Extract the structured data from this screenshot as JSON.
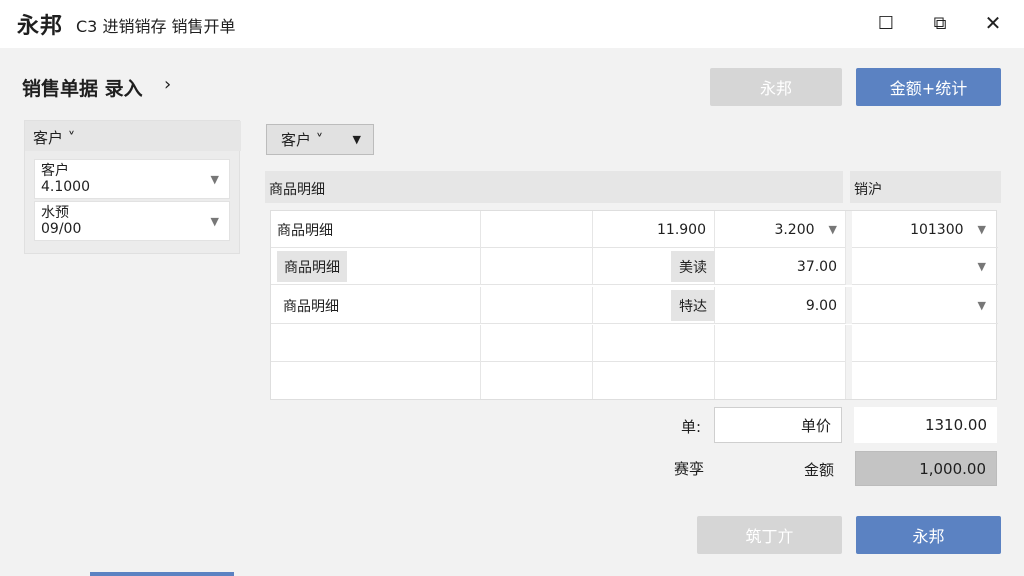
{
  "window": {
    "app_name": "永邦",
    "title": "C3 进销销存 销售开单",
    "controls": {
      "minimize": "☐",
      "restore": "⧉",
      "close": "✕"
    }
  },
  "page": {
    "title": "销售单据 录入",
    "chevron": "›"
  },
  "toolbar": {
    "grey_button": "永邦",
    "blue_button": "金额+统计"
  },
  "left_panel": {
    "header": "客户 ˅",
    "fields": [
      {
        "label": "客户",
        "value": "4.1000"
      },
      {
        "label": "水预",
        "value": "09/00"
      }
    ]
  },
  "filter": {
    "label": "客户 ˅"
  },
  "grid": {
    "header_main": "商品明细",
    "header_side": "销沪",
    "rows": [
      {
        "c1": "商品明细",
        "c3": "11.900",
        "c4": "3.200",
        "c5": "101300"
      },
      {
        "c1": "商品明细",
        "tag": "美读",
        "c4": "37.00",
        "c5": ""
      },
      {
        "c1": "商品明细",
        "tag": "特达",
        "c4": "9.00",
        "c5": ""
      },
      {
        "c1": "",
        "c4": "",
        "c5": ""
      },
      {
        "c1": "",
        "c4": "",
        "c5": ""
      }
    ]
  },
  "summary": {
    "label1": "单:",
    "box1": "单价",
    "total1": "1310.00",
    "label2": "赛孪",
    "label3": "金额",
    "total2": "1,000.00"
  },
  "footer": {
    "grey_button": "筑丁亣",
    "blue_button": "永邦"
  },
  "colors": {
    "accent": "#5b82c2",
    "disabled": "#d6d6d6"
  }
}
